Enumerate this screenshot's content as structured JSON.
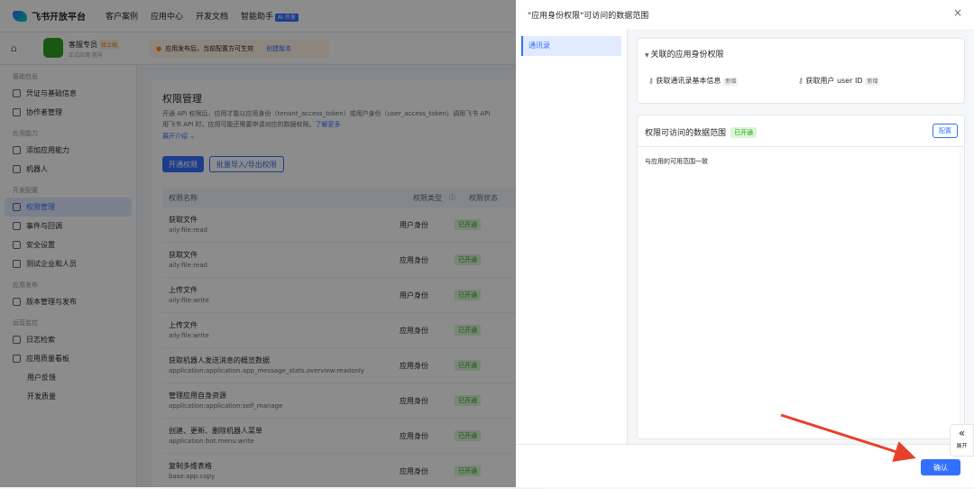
{
  "topbar": {
    "brand": "飞书开放平台",
    "nav": [
      "客户案例",
      "应用中心",
      "开发文档",
      "智能助手"
    ],
    "ai_badge": "AI 开发"
  },
  "app": {
    "name": "客服专员",
    "status": "待上线",
    "subtitle": "正式应用·我导",
    "notice": "应用发布后，当前配置方可生效",
    "notice_link": "创建版本"
  },
  "sidebar": {
    "sections": [
      {
        "title": "基础信息",
        "items": [
          "凭证与基础信息",
          "协作者管理"
        ]
      },
      {
        "title": "应用能力",
        "items": [
          "添加应用能力",
          "机器人"
        ]
      },
      {
        "title": "开发配置",
        "items": [
          "权限管理",
          "事件与回调",
          "安全设置",
          "测试企业和人员"
        ]
      },
      {
        "title": "应用发布",
        "items": [
          "版本管理与发布"
        ]
      },
      {
        "title": "运营监控",
        "items": [
          "日志检索",
          "应用质量看板"
        ]
      }
    ],
    "sub_items": [
      "用户反馈",
      "开发质量"
    ],
    "active": "权限管理"
  },
  "main": {
    "title": "权限管理",
    "desc1": "开通 API 权限后，应用才能以应用身份（tenant_access_token）或用户身份（user_access_token）调用飞书 API",
    "desc2": "用飞书 API 时，应用可能还需要申请对应的数据权限。",
    "learn_more": "了解更多",
    "expand": "展开介绍",
    "btn_enable": "开通权限",
    "btn_batch": "批量导入/导出权限",
    "cols": [
      "权限名称",
      "权限类型",
      "权限状态"
    ],
    "rows": [
      {
        "name": "获取文件",
        "code": "aily:file:read",
        "type": "用户身份",
        "status": "已开通"
      },
      {
        "name": "获取文件",
        "code": "aily:file:read",
        "type": "应用身份",
        "status": "已开通"
      },
      {
        "name": "上传文件",
        "code": "aily:file:write",
        "type": "用户身份",
        "status": "已开通"
      },
      {
        "name": "上传文件",
        "code": "aily:file:write",
        "type": "应用身份",
        "status": "已开通"
      },
      {
        "name": "获取机器人发送消息的概览数据",
        "code": "application:application.app_message_stats.overview:readonly",
        "type": "应用身份",
        "status": "已开通"
      },
      {
        "name": "管理应用自身资源",
        "code": "application:application:self_manage",
        "type": "应用身份",
        "status": "已开通"
      },
      {
        "name": "创建、更新、删除机器人菜单",
        "code": "application:bot.menu:write",
        "type": "应用身份",
        "status": "已开通"
      },
      {
        "name": "复制多维表格",
        "code": "base:app:copy",
        "type": "应用身份",
        "status": "已开通"
      }
    ]
  },
  "drawer": {
    "title": "\"应用身份权限\"可访问的数据范围",
    "tab": "通讯录",
    "linked_title": "关联的应用身份权限",
    "perm1": "获取通讯录基本信息",
    "perm2": "获取用户 user ID",
    "new_tag": "新增",
    "scope_title": "权限可访问的数据范围",
    "scope_status": "已开通",
    "configure": "配置",
    "scope_text": "与应用的可用范围一致",
    "confirm": "确认",
    "expand_label": "展开"
  },
  "colors": {
    "accent": "#3370ff",
    "success": "#2ea121",
    "arrow": "#e8402a"
  }
}
